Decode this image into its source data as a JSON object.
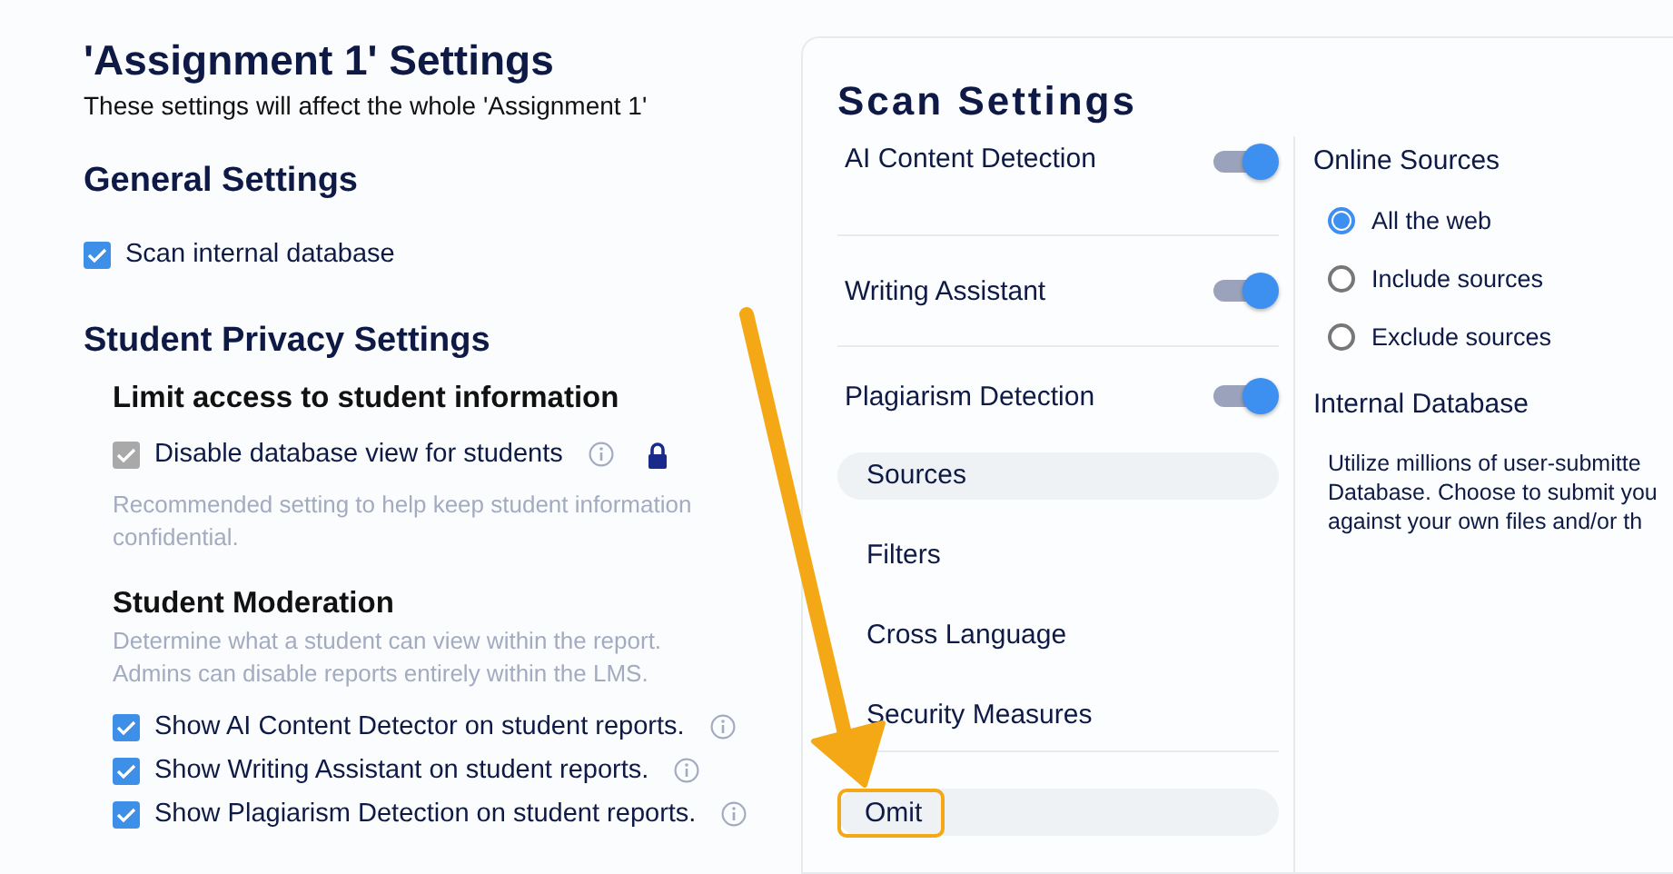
{
  "assignment": {
    "title": "'Assignment 1' Settings",
    "subtitle": "These settings will affect the whole 'Assignment 1'"
  },
  "general": {
    "heading": "General Settings",
    "options": [
      {
        "label": "Scan internal database",
        "checked": true,
        "disabled": false
      }
    ]
  },
  "privacy": {
    "heading": "Student Privacy Settings",
    "limit_access": {
      "heading": "Limit access to student information",
      "option": {
        "label": "Disable database view for students",
        "checked": true,
        "disabled": true,
        "info": true,
        "locked": true
      },
      "hint": "Recommended setting to help keep student information confidential."
    },
    "moderation": {
      "heading": "Student Moderation",
      "description": [
        "Determine what a student can view within the report.",
        "Admins can disable reports entirely within the LMS."
      ],
      "options": [
        {
          "label": "Show AI Content Detector on student reports.",
          "checked": true,
          "info": true
        },
        {
          "label": "Show Writing Assistant on student reports.",
          "checked": true,
          "info": true
        },
        {
          "label": "Show Plagiarism Detection on student reports.",
          "checked": true,
          "info": true
        }
      ]
    }
  },
  "scan_settings": {
    "title": "Scan Settings",
    "toggles": [
      {
        "label": "AI Content Detection",
        "on": true
      },
      {
        "label": "Writing Assistant",
        "on": true
      },
      {
        "label": "Plagiarism Detection",
        "on": true
      }
    ],
    "nav": [
      {
        "label": "Sources",
        "selected": true,
        "highlighted": false,
        "divider_before": false
      },
      {
        "label": "Filters",
        "selected": false,
        "highlighted": false,
        "divider_before": false
      },
      {
        "label": "Cross Language",
        "selected": false,
        "highlighted": false,
        "divider_before": false
      },
      {
        "label": "Security Measures",
        "selected": false,
        "highlighted": false,
        "divider_before": false
      },
      {
        "label": "Omit",
        "selected": true,
        "highlighted": true,
        "divider_before": true
      }
    ],
    "online_sources": {
      "heading": "Online Sources",
      "options": [
        {
          "label": "All the web",
          "selected": true
        },
        {
          "label": "Include sources",
          "selected": false
        },
        {
          "label": "Exclude sources",
          "selected": false
        }
      ]
    },
    "internal_database": {
      "heading": "Internal Database",
      "text": [
        "Utilize millions of user-submitte",
        "Database. Choose to submit you",
        "against your own files and/or th"
      ]
    }
  },
  "annotation": {
    "kind": "arrow"
  }
}
